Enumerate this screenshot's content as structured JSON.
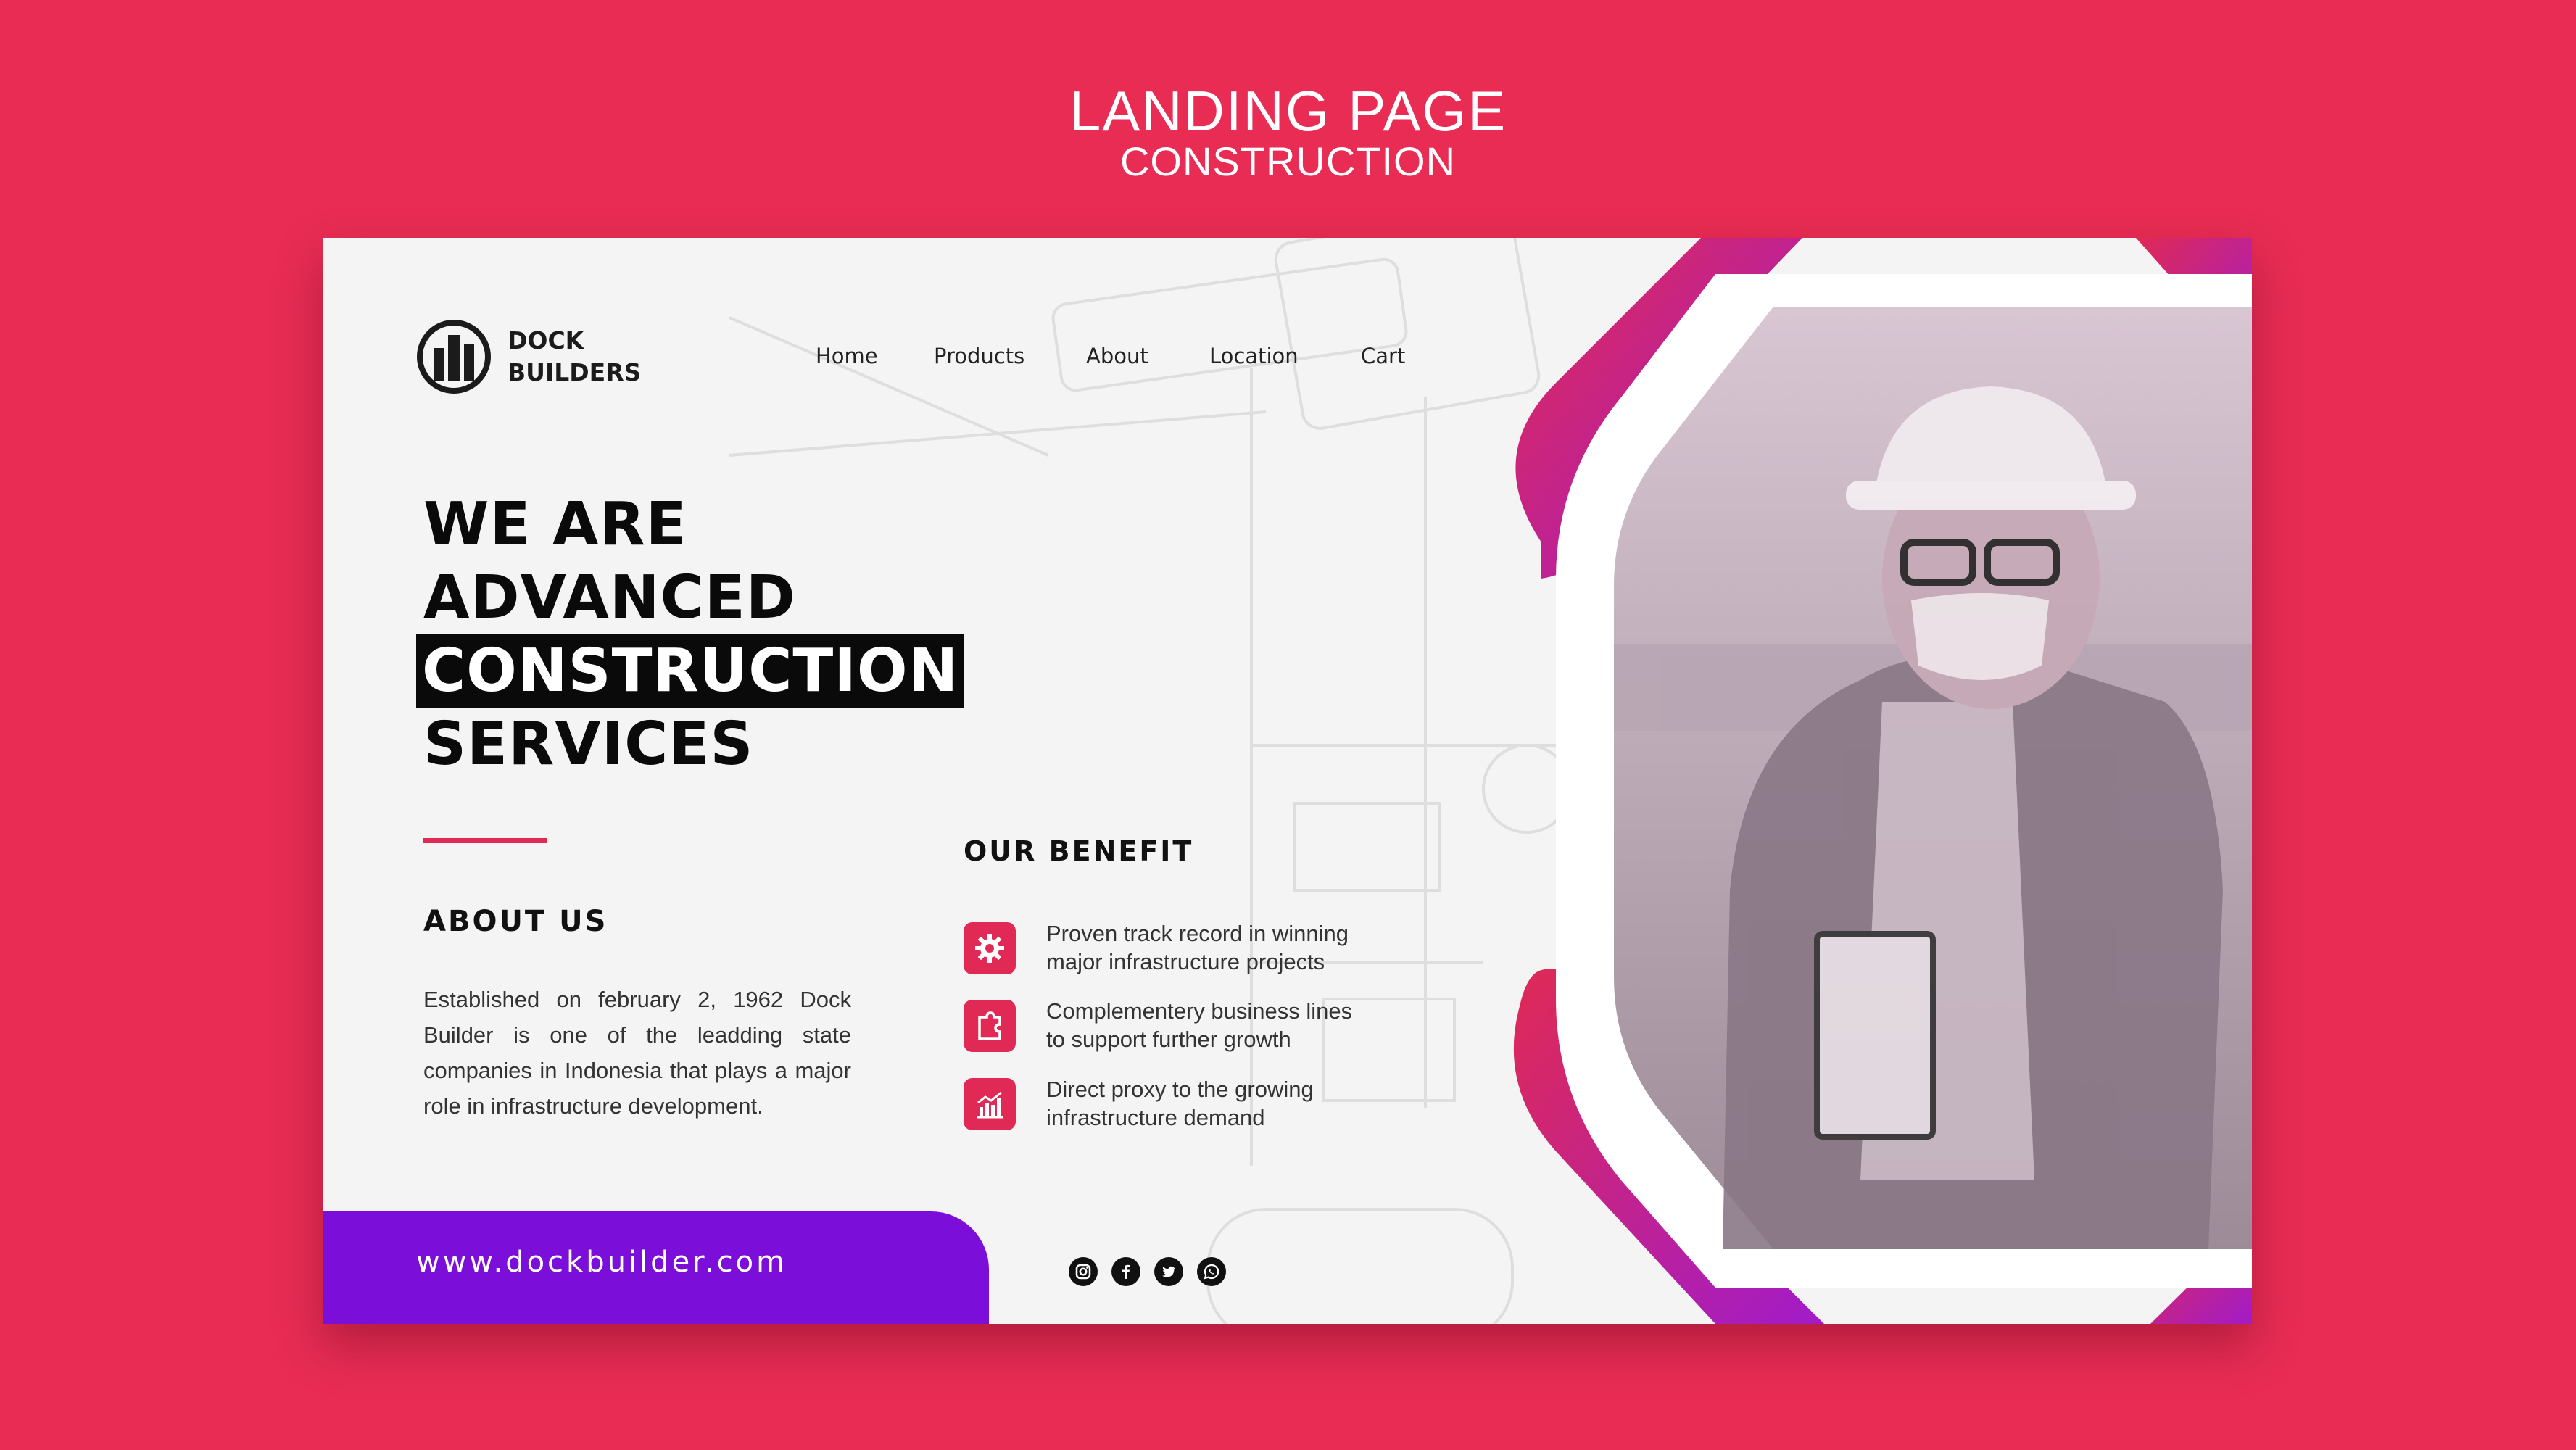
{
  "header": {
    "title": "LANDING PAGE",
    "subtitle": "CONSTRUCTION"
  },
  "brand": {
    "line1": "DOCK",
    "line2": "BUILDERS"
  },
  "nav": {
    "items": [
      "Home",
      "Products",
      "About",
      "Location",
      "Cart"
    ]
  },
  "hero": {
    "line1": "WE ARE",
    "line2": "ADVANCED",
    "line3": "CONSTRUCTION",
    "line4": "SERVICES"
  },
  "about": {
    "title": "ABOUT US",
    "text": "Established on february 2, 1962 Dock Builder is one of the leadding state companies in Indonesia that plays a major role in infrastructure development."
  },
  "benefits": {
    "title": "OUR BENEFIT",
    "items": [
      {
        "icon": "gear-icon",
        "line1": "Proven track record in winning",
        "line2": "major infrastructure projects"
      },
      {
        "icon": "puzzle-icon",
        "line1": "Complementery business lines",
        "line2": "to support further growth"
      },
      {
        "icon": "chart-icon",
        "line1": "Direct proxy to the growing",
        "line2": "infrastructure demand"
      }
    ]
  },
  "footer": {
    "url": "www.dockbuilder.com",
    "socials": [
      "instagram-icon",
      "facebook-icon",
      "twitter-icon",
      "whatsapp-icon"
    ]
  },
  "colors": {
    "background": "#e82c54",
    "accent": "#e02a55",
    "purple": "#7b0ed8",
    "card": "#f4f4f4"
  }
}
